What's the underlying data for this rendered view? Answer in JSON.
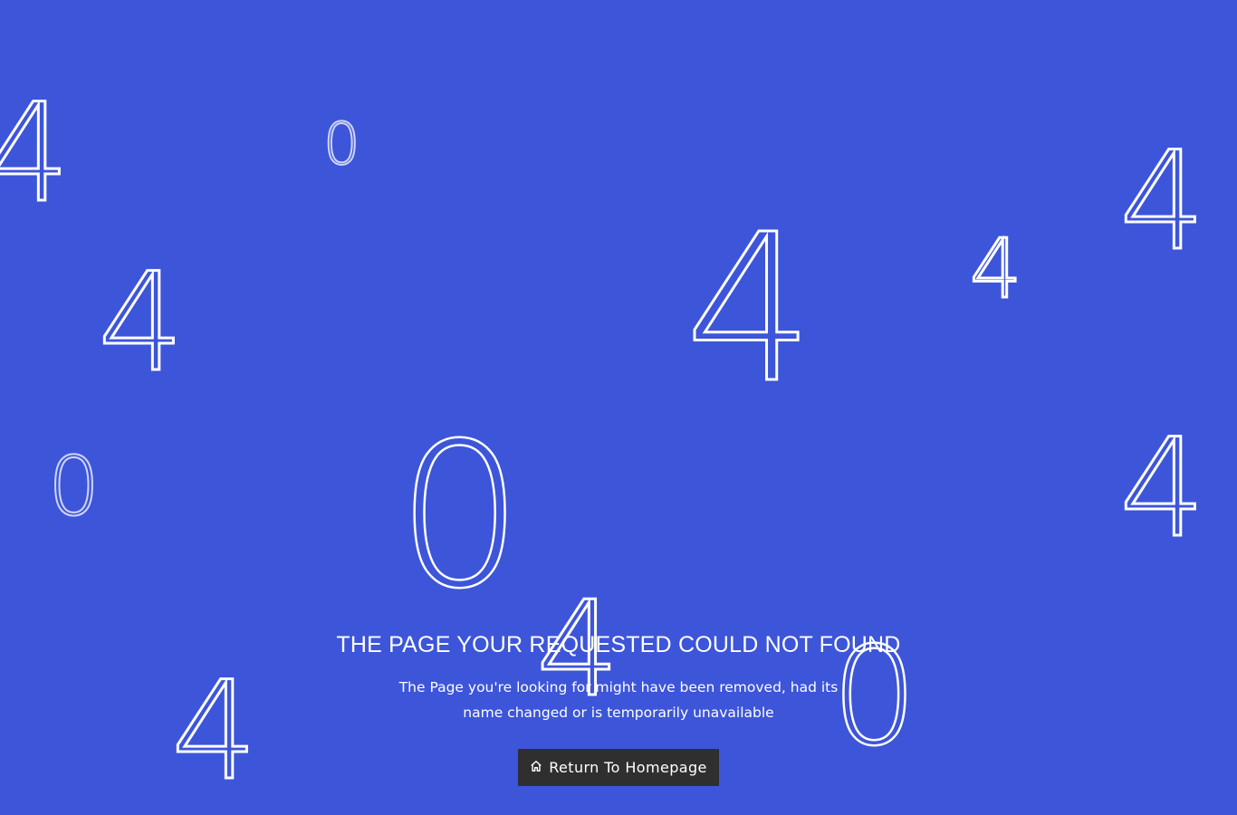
{
  "background_color": "#3d55d9",
  "button_color": "#2f2f30",
  "floating_digits": [
    "4",
    "0",
    "4",
    "4",
    "4",
    "4",
    "0",
    "0",
    "4",
    "4",
    "0",
    "4"
  ],
  "error": {
    "title": "THE PAGE YOUR REQUESTED COULD NOT FOUND",
    "message": "The Page you're looking for might have been removed, had its name changed or is temporarily unavailable",
    "button_label": "Return To Homepage",
    "button_icon": "home-icon"
  }
}
